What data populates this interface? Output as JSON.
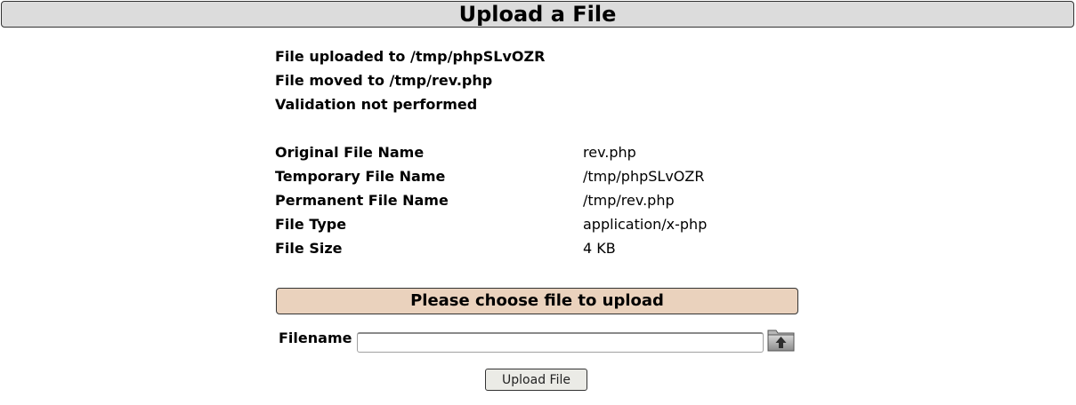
{
  "header": {
    "title": "Upload a File"
  },
  "status": {
    "uploaded": "File uploaded to /tmp/phpSLvOZR",
    "moved": "File moved to /tmp/rev.php",
    "validation": "Validation not performed"
  },
  "file_info": [
    {
      "label": "Original File Name",
      "value": "rev.php"
    },
    {
      "label": "Temporary File Name",
      "value": "/tmp/phpSLvOZR"
    },
    {
      "label": "Permanent File Name",
      "value": "/tmp/rev.php"
    },
    {
      "label": "File Type",
      "value": "application/x-php"
    },
    {
      "label": "File Size",
      "value": "4 KB"
    }
  ],
  "upload_form": {
    "panel_title": "Please choose file to upload",
    "filename_label": "Filename",
    "filename_value": "",
    "browse_icon": "folder-upload-icon",
    "submit_label": "Upload File"
  },
  "colors": {
    "header_bg": "#dcdcdc",
    "panel_bg": "#ead2bd",
    "button_bg": "#ebebe6"
  }
}
